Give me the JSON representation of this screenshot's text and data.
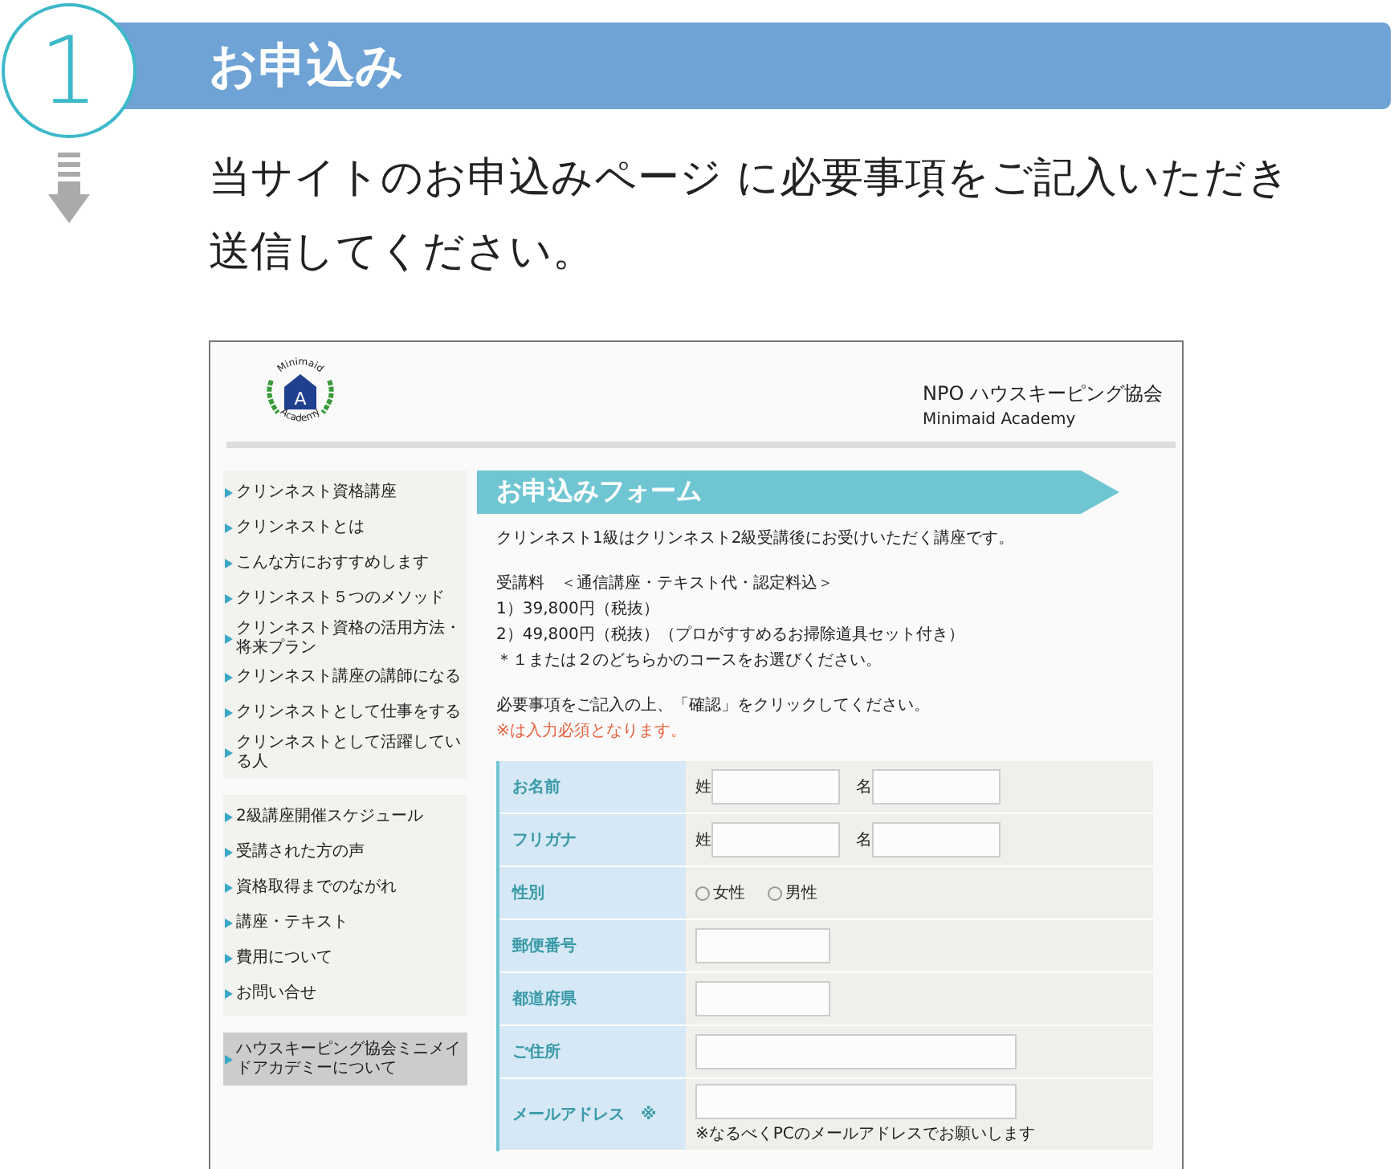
{
  "step": {
    "number": "1",
    "title": "お申込み",
    "description_lines": [
      "当サイトのお申込みページ に必要事項をご記入いただき",
      "送信してください。"
    ]
  },
  "screenshot": {
    "logo": {
      "top_text": "Minimaid",
      "letter": "A",
      "bottom_text": "Academy"
    },
    "site_title": "NPO ハウスキーピング協会",
    "site_subtitle": "Minimaid Academy",
    "sidebar_groups": [
      {
        "highlighted": false,
        "items": [
          "クリンネスト資格講座",
          "クリンネストとは",
          "こんな方におすすめします",
          "クリンネスト５つのメソッド",
          "クリンネスト資格の活用方法・将来プラン",
          "クリンネスト講座の講師になる",
          "クリンネストとして仕事をする",
          "クリンネストとして活躍している人"
        ]
      },
      {
        "highlighted": false,
        "items": [
          "2級講座開催スケジュール",
          "受講された方の声",
          "資格取得までのながれ",
          "講座・テキスト",
          "費用について",
          "お問い合せ"
        ]
      },
      {
        "highlighted": true,
        "items": [
          "ハウスキーピング協会ミニメイドアカデミーについて"
        ]
      }
    ],
    "form_title": "お申込みフォーム",
    "intro": "クリンネスト1級はクリンネスト2級受講後にお受けいただく講座です。",
    "fee_lines": [
      "受講料　＜通信講座・テキスト代・認定料込＞",
      "1）39,800円（税抜）",
      "2）49,800円（税抜）（プロがすすめるお掃除道具セット付き）",
      "＊１または２のどちらかのコースをお選びください。"
    ],
    "instruction": "必要事項をご記入の上、「確認」をクリックしてください。",
    "required_note": "※は入力必須となります。",
    "form_rows": [
      {
        "kind": "pair",
        "label": "お名前",
        "first_label": "姓",
        "second_label": "名"
      },
      {
        "kind": "pair",
        "label": "フリガナ",
        "first_label": "姓",
        "second_label": "名"
      },
      {
        "kind": "radio",
        "label": "性別",
        "options": [
          {
            "label": "女性",
            "selected": false
          },
          {
            "label": "男性",
            "selected": false
          }
        ]
      },
      {
        "kind": "short",
        "label": "郵便番号"
      },
      {
        "kind": "short",
        "label": "都道府県"
      },
      {
        "kind": "long",
        "label": "ご住所"
      },
      {
        "kind": "long",
        "label": "メールアドレス　※",
        "note": "※なるべくPCのメールアドレスでお願いします"
      }
    ]
  }
}
